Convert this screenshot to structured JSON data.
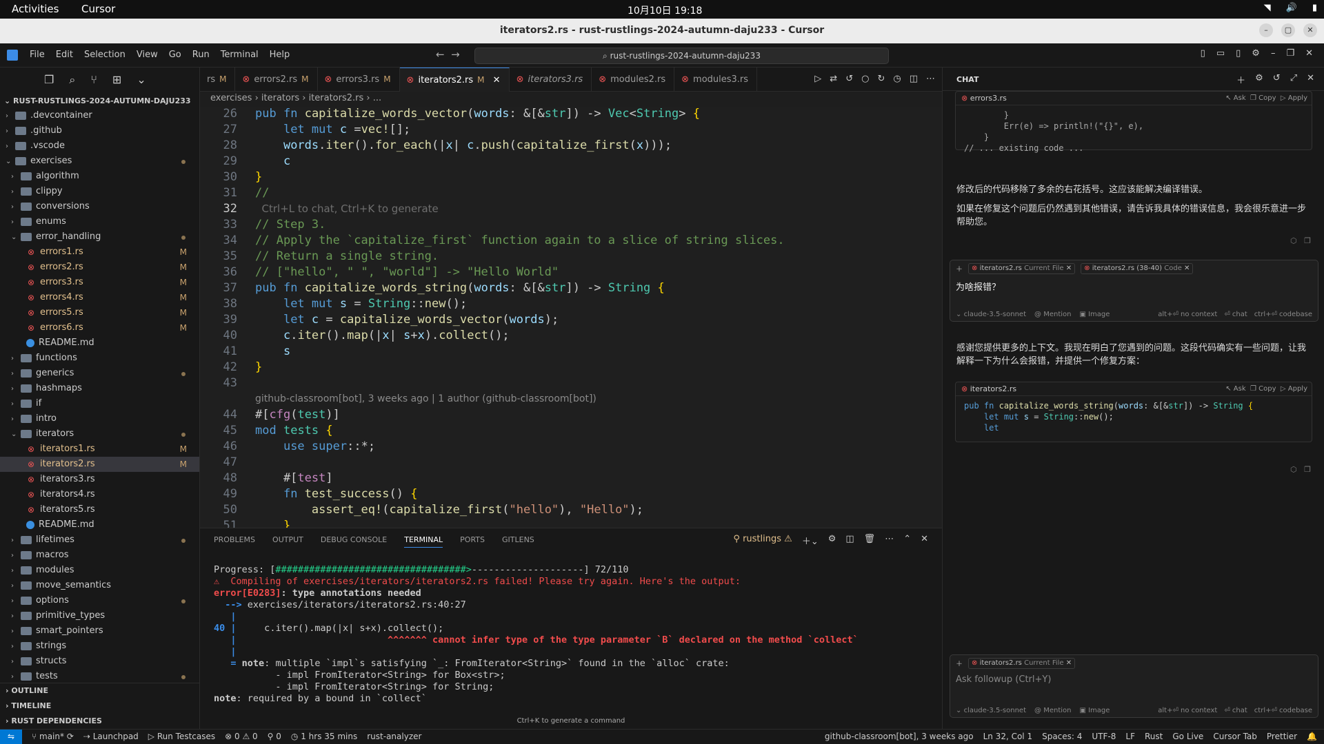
{
  "os_topbar": {
    "activities": "Activities",
    "app": "Cursor",
    "clock": "10月10日  19:18"
  },
  "window": {
    "title": "iterators2.rs - rust-rustlings-2024-autumn-daju233 - Cursor"
  },
  "menu": {
    "items": [
      "File",
      "Edit",
      "Selection",
      "View",
      "Go",
      "Run",
      "Terminal",
      "Help"
    ],
    "search": "rust-rustlings-2024-autumn-daju233"
  },
  "explorer": {
    "root": "RUST-RUSTLINGS-2024-AUTUMN-DAJU233",
    "tree": [
      {
        "label": ".devcontainer",
        "type": "folder",
        "depth": 0,
        "open": false
      },
      {
        "label": ".github",
        "type": "folder",
        "depth": 0,
        "open": false
      },
      {
        "label": ".vscode",
        "type": "folder",
        "depth": 0,
        "open": false
      },
      {
        "label": "exercises",
        "type": "folder",
        "depth": 0,
        "open": true,
        "dot": true
      },
      {
        "label": "algorithm",
        "type": "folder",
        "depth": 1,
        "open": false
      },
      {
        "label": "clippy",
        "type": "folder",
        "depth": 1,
        "open": false
      },
      {
        "label": "conversions",
        "type": "folder",
        "depth": 1,
        "open": false
      },
      {
        "label": "enums",
        "type": "folder",
        "depth": 1,
        "open": false
      },
      {
        "label": "error_handling",
        "type": "folder",
        "depth": 1,
        "open": true,
        "dot": true
      },
      {
        "label": "errors1.rs",
        "type": "rs",
        "depth": 2,
        "badge": "M"
      },
      {
        "label": "errors2.rs",
        "type": "rs",
        "depth": 2,
        "badge": "M"
      },
      {
        "label": "errors3.rs",
        "type": "rs",
        "depth": 2,
        "badge": "M"
      },
      {
        "label": "errors4.rs",
        "type": "rs",
        "depth": 2,
        "badge": "M"
      },
      {
        "label": "errors5.rs",
        "type": "rs",
        "depth": 2,
        "badge": "M"
      },
      {
        "label": "errors6.rs",
        "type": "rs",
        "depth": 2,
        "badge": "M"
      },
      {
        "label": "README.md",
        "type": "info",
        "depth": 2
      },
      {
        "label": "functions",
        "type": "folder",
        "depth": 1,
        "open": false
      },
      {
        "label": "generics",
        "type": "folder",
        "depth": 1,
        "open": false,
        "dot": true
      },
      {
        "label": "hashmaps",
        "type": "folder",
        "depth": 1,
        "open": false
      },
      {
        "label": "if",
        "type": "folder",
        "depth": 1,
        "open": false
      },
      {
        "label": "intro",
        "type": "folder",
        "depth": 1,
        "open": false
      },
      {
        "label": "iterators",
        "type": "folder",
        "depth": 1,
        "open": true,
        "dot": true
      },
      {
        "label": "iterators1.rs",
        "type": "rs",
        "depth": 2,
        "badge": "M"
      },
      {
        "label": "iterators2.rs",
        "type": "rs",
        "depth": 2,
        "badge": "M",
        "selected": true
      },
      {
        "label": "iterators3.rs",
        "type": "rs",
        "depth": 2
      },
      {
        "label": "iterators4.rs",
        "type": "rs",
        "depth": 2
      },
      {
        "label": "iterators5.rs",
        "type": "rs",
        "depth": 2
      },
      {
        "label": "README.md",
        "type": "info",
        "depth": 2
      },
      {
        "label": "lifetimes",
        "type": "folder",
        "depth": 1,
        "open": false,
        "dot": true
      },
      {
        "label": "macros",
        "type": "folder",
        "depth": 1,
        "open": false
      },
      {
        "label": "modules",
        "type": "folder",
        "depth": 1,
        "open": false
      },
      {
        "label": "move_semantics",
        "type": "folder",
        "depth": 1,
        "open": false
      },
      {
        "label": "options",
        "type": "folder",
        "depth": 1,
        "open": false,
        "dot": true
      },
      {
        "label": "primitive_types",
        "type": "folder",
        "depth": 1,
        "open": false
      },
      {
        "label": "smart_pointers",
        "type": "folder",
        "depth": 1,
        "open": false
      },
      {
        "label": "strings",
        "type": "folder",
        "depth": 1,
        "open": false
      },
      {
        "label": "structs",
        "type": "folder",
        "depth": 1,
        "open": false
      },
      {
        "label": "tests",
        "type": "folder",
        "depth": 1,
        "open": false,
        "dot": true
      }
    ],
    "sections": [
      "OUTLINE",
      "TIMELINE",
      "RUST DEPENDENCIES"
    ]
  },
  "tabs": [
    {
      "label": "rs",
      "mod": "M",
      "partial": true
    },
    {
      "label": "errors2.rs",
      "mod": "M"
    },
    {
      "label": "errors3.rs",
      "mod": "M"
    },
    {
      "label": "iterators2.rs",
      "mod": "M",
      "active": true
    },
    {
      "label": "iterators3.rs",
      "italic": true
    },
    {
      "label": "modules2.rs"
    },
    {
      "label": "modules3.rs"
    }
  ],
  "breadcrumb": [
    "exercises",
    "iterators",
    "iterators2.rs",
    "..."
  ],
  "editor": {
    "lines": [
      {
        "n": "26",
        "html": "<span class=\"kw\">pub</span> <span class=\"kw\">fn</span> <span class=\"fn\">capitalize_words_vector</span>(<span class=\"vr\">words</span>: &amp;[&amp;<span class=\"ty\">str</span>]) -&gt; <span class=\"ty\">Vec</span>&lt;<span class=\"ty\">String</span>&gt; <span class=\"pu\">{</span>"
      },
      {
        "n": "27",
        "html": "    <span class=\"kw\">let</span> <span class=\"kw\">mut</span> <span class=\"vr\">c</span> =<span class=\"fn\">vec!</span>[];"
      },
      {
        "n": "28",
        "html": "    <span class=\"vr\">words</span>.<span class=\"fn\">iter</span>().<span class=\"fn\">for_each</span>(|<span class=\"vr\">x</span>| <span class=\"vr\">c</span>.<span class=\"fn\">push</span>(<span class=\"fn\">capitalize_first</span>(<span class=\"vr\">x</span>)));"
      },
      {
        "n": "29",
        "html": "    <span class=\"vr\">c</span>"
      },
      {
        "n": "30",
        "html": "<span class=\"pu\">}</span>"
      },
      {
        "n": "31",
        "html": "<span class=\"cm\">//</span>"
      },
      {
        "n": "32",
        "html": "<span class=\"hint\">  Ctrl+L to chat, Ctrl+K to generate</span>",
        "cur": true
      },
      {
        "n": "33",
        "html": "<span class=\"cm\">// Step 3.</span>"
      },
      {
        "n": "34",
        "html": "<span class=\"cm\">// Apply the `capitalize_first` function again to a slice of string slices.</span>"
      },
      {
        "n": "35",
        "html": "<span class=\"cm\">// Return a single string.</span>"
      },
      {
        "n": "36",
        "html": "<span class=\"cm\">// [\"hello\", \" \", \"world\"] -&gt; \"Hello World\"</span>"
      },
      {
        "n": "37",
        "html": "<span class=\"kw\">pub</span> <span class=\"kw\">fn</span> <span class=\"fn\">capitalize_words_string</span>(<span class=\"vr\">words</span>: &amp;[&amp;<span class=\"ty\">str</span>]) -&gt; <span class=\"ty\">String</span> <span class=\"pu\">{</span>"
      },
      {
        "n": "38",
        "html": "    <span class=\"kw\">let</span> <span class=\"kw\">mut</span> <span class=\"vr\">s</span> = <span class=\"ty\">String</span>::<span class=\"fn\">new</span>();"
      },
      {
        "n": "39",
        "html": "    <span class=\"kw\">let</span> <span class=\"vr\">c</span> = <span class=\"fn\">capitalize_words_vector</span>(<span class=\"vr\">words</span>);"
      },
      {
        "n": "40",
        "html": "    <span class=\"vr\">c</span>.<span class=\"fn\">iter</span>().<span class=\"fn\">map</span>(|<span class=\"vr\">x</span>| <span class=\"vr\">s</span>+<span class=\"vr\">x</span>).<span class=\"fn\">collect</span>();"
      },
      {
        "n": "41",
        "html": "    <span class=\"vr\">s</span>"
      },
      {
        "n": "42",
        "html": "<span class=\"pu\">}</span>"
      },
      {
        "n": "43",
        "html": ""
      },
      {
        "n": "",
        "blame": "github-classroom[bot], 3 weeks ago | 1 author (github-classroom[bot])"
      },
      {
        "n": "44",
        "html": "#[<span class=\"ma\">cfg</span>(<span class=\"ty\">test</span>)]"
      },
      {
        "n": "45",
        "html": "<span class=\"kw\">mod</span> <span class=\"ty\">tests</span> <span class=\"pu\">{</span>"
      },
      {
        "n": "46",
        "html": "    <span class=\"kw\">use</span> <span class=\"kw\">super</span>::*;"
      },
      {
        "n": "47",
        "html": ""
      },
      {
        "n": "48",
        "html": "    #[<span class=\"ma\">test</span>]"
      },
      {
        "n": "49",
        "html": "    <span class=\"kw\">fn</span> <span class=\"fn\">test_success</span>() <span class=\"pu\">{</span>"
      },
      {
        "n": "50",
        "html": "        <span class=\"fn\">assert_eq!</span>(<span class=\"fn\">capitalize_first</span>(<span class=\"st\">\"hello\"</span>), <span class=\"st\">\"Hello\"</span>);"
      },
      {
        "n": "51",
        "html": "    <span class=\"pu\">}</span>"
      }
    ]
  },
  "panel": {
    "tabs": [
      "PROBLEMS",
      "OUTPUT",
      "DEBUG CONSOLE",
      "TERMINAL",
      "PORTS",
      "GITLENS"
    ],
    "active_tab": "TERMINAL",
    "shell": "rustlings",
    "terminal_html": "Progress: [<span class=\"tg\">##################################&gt;</span>--------------------] 72/110\n<span class=\"tr\">⚠  Compiling of exercises/iterators/iterators2.rs failed! Please try again. Here's the output:</span>\n<span class=\"tr bo\">error[E0283]</span><span class=\"bo\">: type annotations needed</span>\n  <span class=\"tb bo\">--&gt;</span> exercises/iterators/iterators2.rs:40:27\n   <span class=\"tb bo\">|</span>\n<span class=\"tb bo\">40</span> <span class=\"tb bo\">|</span>     c.iter().map(|x| s+x).collect();\n   <span class=\"tb bo\">|</span>                           <span class=\"tr bo\">^^^^^^^ cannot infer type of the type parameter `B` declared on the method `collect`</span>\n   <span class=\"tb bo\">|</span>\n   <span class=\"tb bo\">=</span> <span class=\"bo\">note</span>: multiple `impl`s satisfying `_: FromIterator&lt;String&gt;` found in the `alloc` crate:\n           - impl FromIterator&lt;String&gt; for Box&lt;str&gt;;\n           - impl FromIterator&lt;String&gt; for String;\n<span class=\"bo\">note</span>: required by a bound in `collect`",
    "footer_hint": "Ctrl+K to generate a command"
  },
  "chat": {
    "title": "CHAT",
    "block1": {
      "file": "errors3.rs",
      "ask": "Ask",
      "copy": "Copy",
      "apply": "Apply",
      "code": "        }\n        Err(e) => println!(\"{}\", e),\n    }\n// ... existing code ..."
    },
    "msg1": "修改后的代码移除了多余的右花括号。这应该能解决编译错误。",
    "msg2": "如果在修复这个问题后仍然遇到其他错误，请告诉我具体的错误信息，我会很乐意进一步帮助您。",
    "input1": {
      "chip1": "iterators2.rs",
      "chip1_sub": "Current File",
      "chip2": "iterators2.rs (38-40)",
      "chip2_sub": "Code",
      "text": "为啥报错？"
    },
    "model": "claude-3.5-sonnet",
    "mention": "@ Mention",
    "image": "Image",
    "no_context": "alt+⏎ no context",
    "chat_opt": "⏎ chat",
    "codebase": "ctrl+⏎ codebase",
    "msg3": "感谢您提供更多的上下文。我现在明白了您遇到的问题。这段代码确实有一些问题，让我解释一下为什么会报错，并提供一个修复方案：",
    "block2": {
      "file": "iterators2.rs",
      "ask": "Ask",
      "copy": "Copy",
      "apply": "Apply"
    },
    "input2": {
      "chip1": "iterators2.rs",
      "chip1_sub": "Current File",
      "placeholder": "Ask followup (Ctrl+Y)"
    }
  },
  "status": {
    "branch": "main*",
    "launchpad": "Launchpad",
    "run_tests": "Run Testcases",
    "problems": "⊗ 0 ⚠ 0",
    "ports": "⚲ 0",
    "time": "1 hrs 35 mins",
    "analyzer": "rust-analyzer",
    "blame": "github-classroom[bot], 3 weeks ago",
    "pos": "Ln 32, Col 1",
    "spaces": "Spaces: 4",
    "enc": "UTF-8",
    "eol": "LF",
    "lang": "Rust",
    "golive": "Go Live",
    "cursortab": "Cursor Tab",
    "prettier": "Prettier"
  }
}
